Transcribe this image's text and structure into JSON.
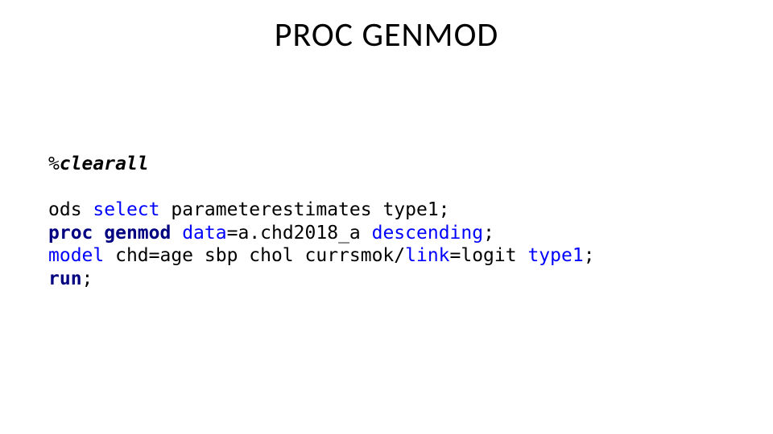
{
  "title": "PROC GENMOD",
  "code": {
    "macro_pct": "%",
    "macro_name": "clearall",
    "l1_ods": "ods",
    "l1_sp1": " ",
    "l1_select": "select",
    "l1_rest": " parameterestimates type1;",
    "l2_proc": "proc",
    "l2_sp1": " ",
    "l2_genmod": "genmod",
    "l2_sp2": " ",
    "l2_data": "data",
    "l2_eq1": "=a.chd2018_a ",
    "l2_desc": "descending",
    "l2_semi": ";",
    "l3_model": "model",
    "l3_mid": " chd=age sbp chol currsmok/",
    "l3_link": "link",
    "l3_eqlogit": "=logit ",
    "l3_type1": "type1",
    "l3_semi": ";",
    "l4_run": "run",
    "l4_semi": ";"
  }
}
